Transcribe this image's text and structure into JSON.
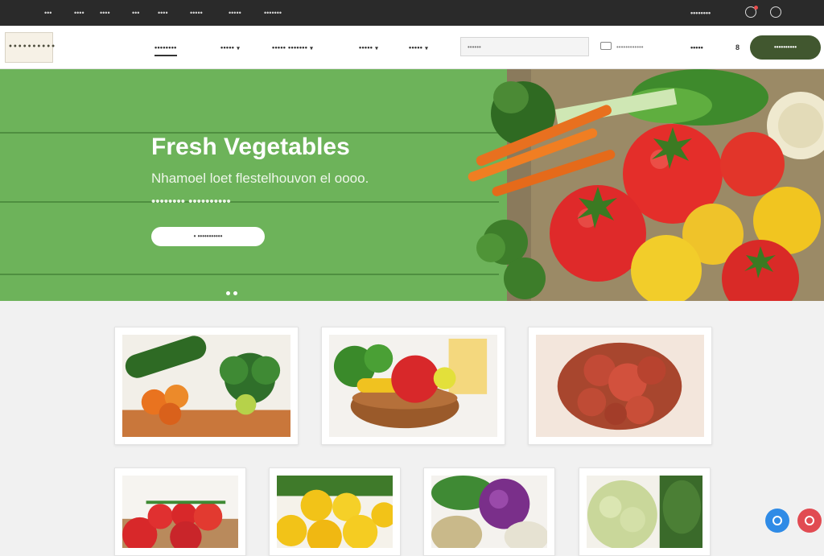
{
  "topbar": {
    "links": [
      "•••",
      "••••",
      "••••",
      "•••",
      "••••",
      "•••••",
      "•••••",
      "•••••••"
    ],
    "right_text": "••••••••",
    "icons": [
      "bell-icon",
      "globe-icon"
    ]
  },
  "navbar": {
    "logo_text": "••••••••••",
    "items": [
      {
        "label": "••••••••",
        "caret": ""
      },
      {
        "label": "•••••",
        "caret": "▾"
      },
      {
        "label": "••••• •••••••",
        "caret": "▾"
      },
      {
        "label": "•••••",
        "caret": "▾"
      },
      {
        "label": "•••••",
        "caret": "▾"
      }
    ],
    "search_placeholder": "••••••",
    "contact_text": "••••••••••••",
    "account_text": "•••••",
    "cart_count": "8",
    "cta_label": "••••••••••",
    "accent": "#41572f"
  },
  "hero": {
    "title": "Fresh Vegetables",
    "subtitle_1": "Nhamoel loet flestelhouvon el oooo.",
    "subtitle_2": "•••••••• ••••••••••",
    "button_label": "• •••••••••••",
    "slide_count": 2,
    "background": "#6db35a"
  },
  "products": {
    "row1": [
      "vegetables",
      "fruit-bowl",
      "strawberries"
    ],
    "row2": [
      "tomatoes",
      "yellow-peppers",
      "cabbage",
      "cauliflower"
    ]
  },
  "floating": {
    "icons": [
      "chat-icon",
      "help-icon"
    ]
  }
}
